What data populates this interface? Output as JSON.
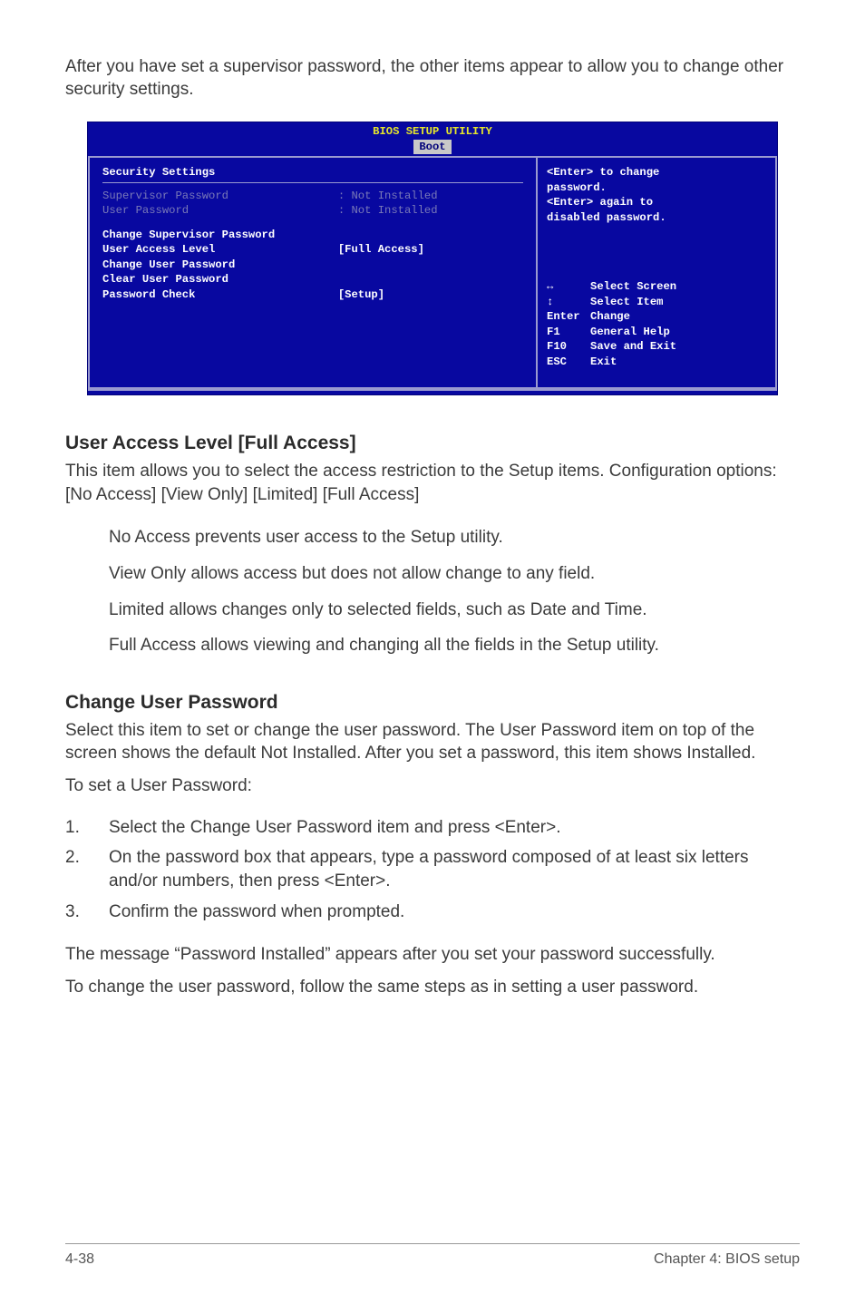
{
  "intro": "After you have set a supervisor password, the other items appear to allow you to change other security settings.",
  "bios": {
    "title": "BIOS SETUP UTILITY",
    "tab": "Boot",
    "section_heading": "Security Settings",
    "supervisor_password_label": "Supervisor Password",
    "supervisor_password_value": ": Not Installed",
    "user_password_label": "User Password",
    "user_password_value": ": Not Installed",
    "change_supervisor_password": "Change Supervisor Password",
    "user_access_level_label": "User Access Level",
    "user_access_level_value": "[Full Access]",
    "change_user_password": "Change User Password",
    "clear_user_password": "Clear User Password",
    "password_check_label": "Password Check",
    "password_check_value": "[Setup]",
    "help": {
      "line1": "<Enter> to change",
      "line2": "password.",
      "line3": "<Enter> again to",
      "line4": "disabled password."
    },
    "nav": {
      "select_screen": "Select Screen",
      "select_item": "Select Item",
      "enter_key": "Enter",
      "enter_label": "Change",
      "f1_key": "F1",
      "f1_label": "General Help",
      "f10_key": "F10",
      "f10_label": "Save and Exit",
      "esc_key": "ESC",
      "esc_label": "Exit"
    }
  },
  "ual": {
    "heading": "User Access Level [Full Access]",
    "p1": "This item allows you to select the access restriction to the Setup items. Configuration options: [No Access] [View Only] [Limited] [Full Access]",
    "opt1": "No Access prevents user access to the Setup utility.",
    "opt2": "View Only allows access but does not allow change to any field.",
    "opt3": "Limited allows changes only to selected fields, such as Date and Time.",
    "opt4": "Full Access allows viewing and changing all the fields in the Setup utility."
  },
  "cup": {
    "heading": "Change User Password",
    "p1": "Select this item to set or change the user password. The User Password item on top of the screen shows the default Not Installed. After you set a password, this item shows Installed.",
    "p2": "To set a User Password:",
    "step1": "Select the Change User Password item and press <Enter>.",
    "step2": "On the password box that appears, type a password composed of at least six letters and/or numbers, then press <Enter>.",
    "step3": "Confirm the password when prompted.",
    "p3": "The message “Password Installed” appears after you set your password successfully.",
    "p4": "To change the user password, follow the same steps as in setting a user password."
  },
  "footer": {
    "left": "4-38",
    "right": "Chapter 4: BIOS setup"
  }
}
